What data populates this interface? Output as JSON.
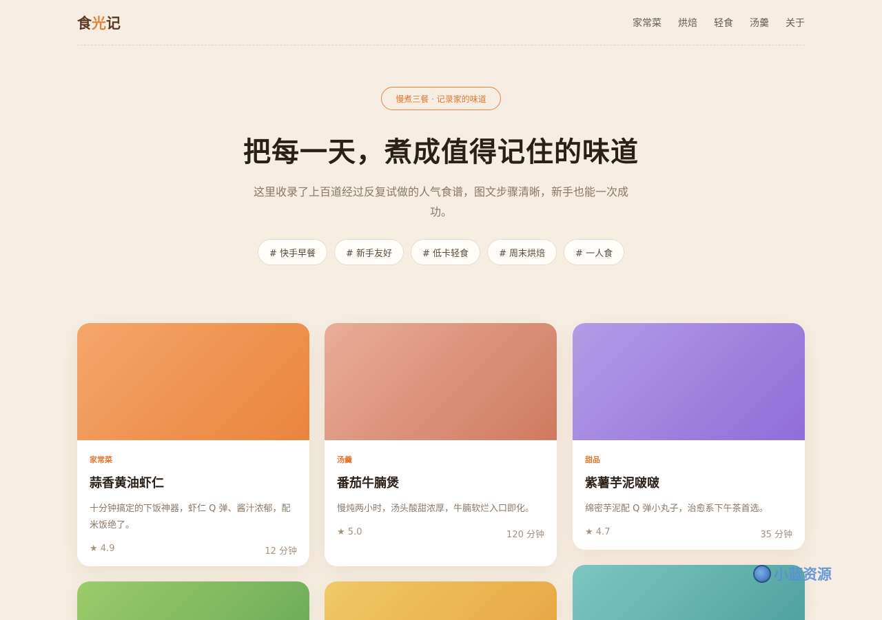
{
  "header": {
    "logo": [
      "食",
      "光",
      "记"
    ],
    "nav": [
      "家常菜",
      "烘焙",
      "轻食",
      "汤羹",
      "关于"
    ]
  },
  "hero": {
    "badge": "慢煮三餐 · 记录家的味道",
    "title": "把每一天，煮成值得记住的味道",
    "subtitle": "这里收录了上百道经过反复试做的人气食谱，图文步骤清晰，新手也能一次成功。",
    "tags": [
      "# 快手早餐",
      "# 新手友好",
      "# 低卡轻食",
      "# 周末烘焙",
      "# 一人食"
    ]
  },
  "cards": [
    {
      "category": "家常菜",
      "name": "蒜香黄油虾仁",
      "desc": "十分钟搞定的下饭神器，虾仁 Q 弹、酱汁浓郁，配米饭绝了。",
      "rating": "★ 4.9",
      "time": "12 分钟",
      "gradient": [
        "#f4a66b",
        "#ea843c"
      ]
    },
    {
      "category": "汤羹",
      "name": "番茄牛腩煲",
      "desc": "慢炖两小时，汤头酸甜浓厚，牛腩软烂入口即化。",
      "rating": "★ 5.0",
      "time": "120 分钟",
      "gradient": [
        "#e8ad98",
        "#cf7a5f"
      ]
    },
    {
      "category": "甜品",
      "name": "紫薯芋泥啵啵",
      "desc": "绵密芋泥配 Q 弹小丸子，治愈系下午茶首选。",
      "rating": "★ 4.7",
      "time": "35 分钟",
      "gradient": [
        "#b39ce6",
        "#8f6ed8"
      ]
    }
  ],
  "partial_cards": [
    {
      "gradient": [
        "#9ccb6a",
        "#6fae5c"
      ]
    },
    {
      "gradient": [
        "#f0c968",
        "#e6a944"
      ]
    },
    {
      "gradient": [
        "#7dc6c0",
        "#4fa3a3"
      ]
    }
  ],
  "watermark": "小蓝资源"
}
